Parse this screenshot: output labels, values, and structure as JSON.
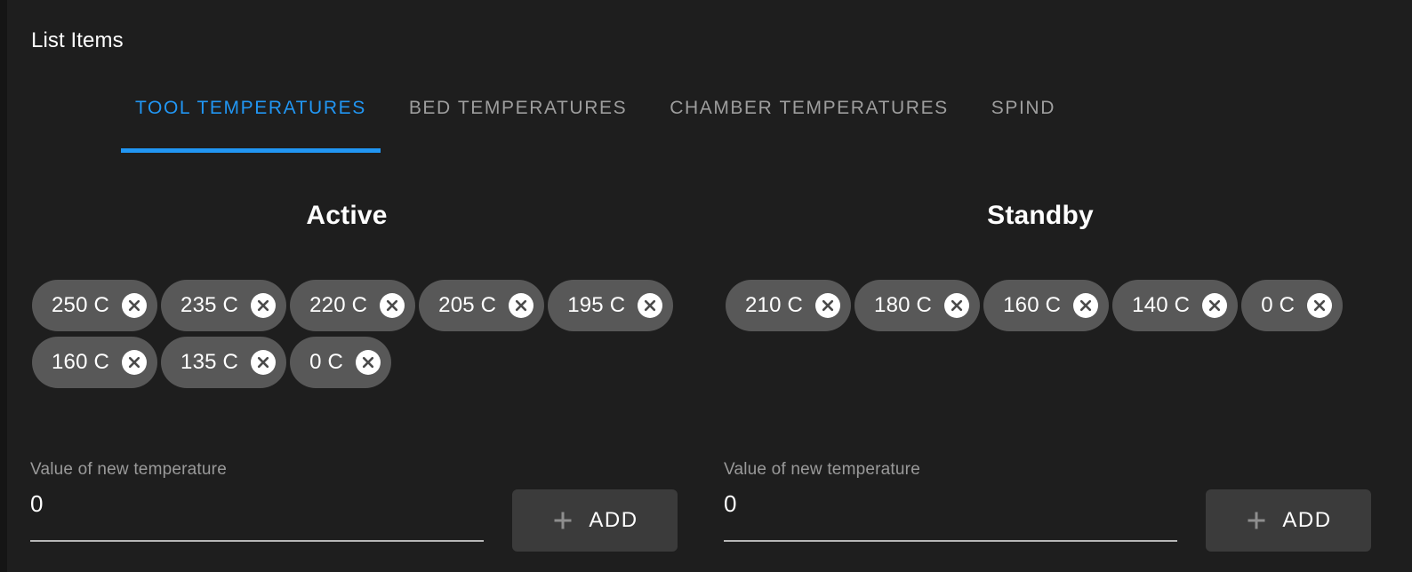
{
  "header": {
    "title": "List Items"
  },
  "tabs": [
    {
      "label": "Tool Temperatures",
      "active": true
    },
    {
      "label": "Bed Temperatures",
      "active": false
    },
    {
      "label": "Chamber Temperatures",
      "active": false
    },
    {
      "label": "Spind",
      "active": false
    }
  ],
  "columns": [
    {
      "heading": "Active",
      "chips": [
        {
          "label": "250 C"
        },
        {
          "label": "235 C"
        },
        {
          "label": "220 C"
        },
        {
          "label": "205 C"
        },
        {
          "label": "195 C"
        },
        {
          "label": "160 C"
        },
        {
          "label": "135 C"
        },
        {
          "label": "0 C"
        }
      ],
      "input": {
        "label": "Value of new temperature",
        "value": "0",
        "placeholder": "0"
      },
      "add_button": {
        "label": "ADD",
        "icon": "plus-icon"
      }
    },
    {
      "heading": "Standby",
      "chips": [
        {
          "label": "210 C"
        },
        {
          "label": "180 C"
        },
        {
          "label": "160 C"
        },
        {
          "label": "140 C"
        },
        {
          "label": "0 C"
        }
      ],
      "input": {
        "label": "Value of new temperature",
        "value": "0",
        "placeholder": "0"
      },
      "add_button": {
        "label": "ADD",
        "icon": "plus-icon"
      }
    }
  ],
  "icons": {
    "chip_delete": "close-circle-icon",
    "add": "plus-icon"
  },
  "colors": {
    "background": "#1e1e1e",
    "gutter": "#151515",
    "accent": "#2196f3",
    "chip_background": "#585858",
    "chip_text": "#ffffff",
    "tab_inactive": "#9e9e9e",
    "label_text": "#9a9a9a",
    "underline": "#b7b7b7",
    "button_background": "#3b3b3b"
  }
}
